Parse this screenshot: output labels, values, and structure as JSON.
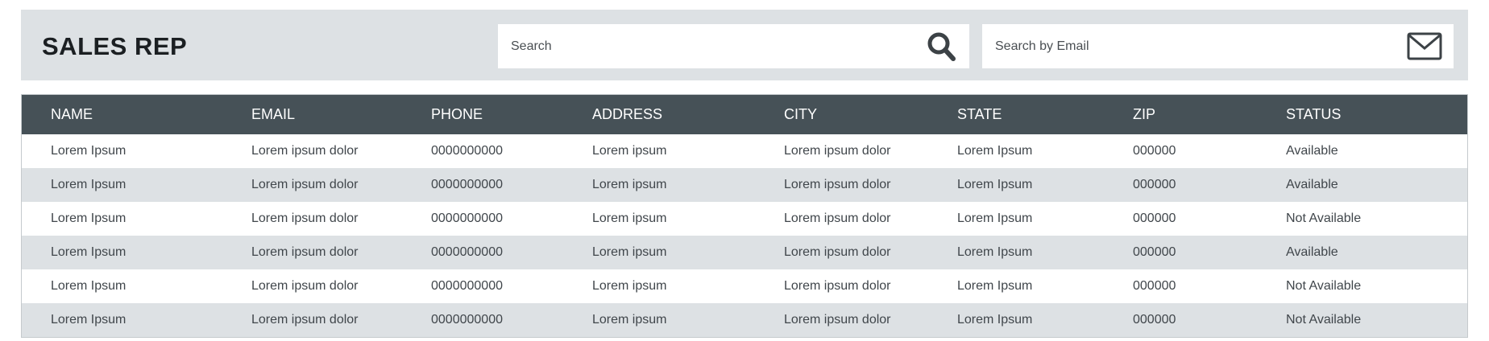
{
  "header": {
    "title": "SALES REP",
    "search_placeholder": "Search",
    "email_search_placeholder": "Search by Email",
    "search_icon": "search-icon",
    "email_icon": "envelope-icon"
  },
  "colors": {
    "header_bg": "#dde1e4",
    "table_head_bg": "#465157",
    "row_alt_bg": "#dde1e4"
  },
  "table": {
    "columns": [
      "NAME",
      "EMAIL",
      "PHONE",
      "ADDRESS",
      "CITY",
      "STATE",
      "ZIP",
      "STATUS"
    ],
    "rows": [
      [
        "Lorem Ipsum",
        "Lorem ipsum dolor",
        "0000000000",
        "Lorem ipsum",
        "Lorem ipsum dolor",
        "Lorem Ipsum",
        "000000",
        "Available"
      ],
      [
        "Lorem Ipsum",
        "Lorem ipsum dolor",
        "0000000000",
        "Lorem ipsum",
        "Lorem ipsum dolor",
        "Lorem Ipsum",
        "000000",
        "Available"
      ],
      [
        "Lorem Ipsum",
        "Lorem ipsum dolor",
        "0000000000",
        "Lorem ipsum",
        "Lorem ipsum dolor",
        "Lorem Ipsum",
        "000000",
        "Not Available"
      ],
      [
        "Lorem Ipsum",
        "Lorem ipsum dolor",
        "0000000000",
        "Lorem ipsum",
        "Lorem ipsum dolor",
        "Lorem Ipsum",
        "000000",
        "Available"
      ],
      [
        "Lorem Ipsum",
        "Lorem ipsum dolor",
        "0000000000",
        "Lorem ipsum",
        "Lorem ipsum dolor",
        "Lorem Ipsum",
        "000000",
        "Not Available"
      ],
      [
        "Lorem Ipsum",
        "Lorem ipsum dolor",
        "0000000000",
        "Lorem ipsum",
        "Lorem ipsum dolor",
        "Lorem Ipsum",
        "000000",
        "Not Available"
      ]
    ]
  }
}
